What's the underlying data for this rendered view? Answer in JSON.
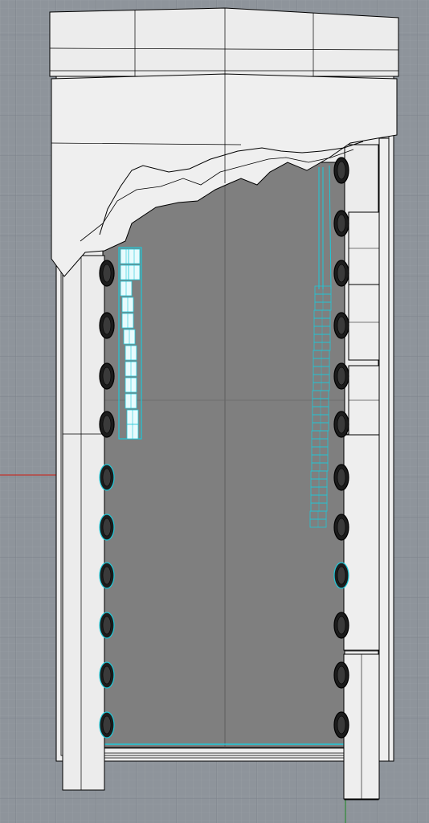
{
  "viewport": {
    "name": "cad-viewport",
    "view": "top",
    "background_color": "#8e949b",
    "grid_minor_color": "#9aa0a7",
    "grid_major_color": "#6f757c",
    "model_fill_color": "#ededed",
    "model_shadow_color": "#dcdcdc",
    "interior_fill_color": "#7f7f7f",
    "edge_color": "#000000",
    "selection_color": "#1ec8d8",
    "x_axis_color": "#c0302a",
    "y_axis_color": "#2f8a36"
  }
}
